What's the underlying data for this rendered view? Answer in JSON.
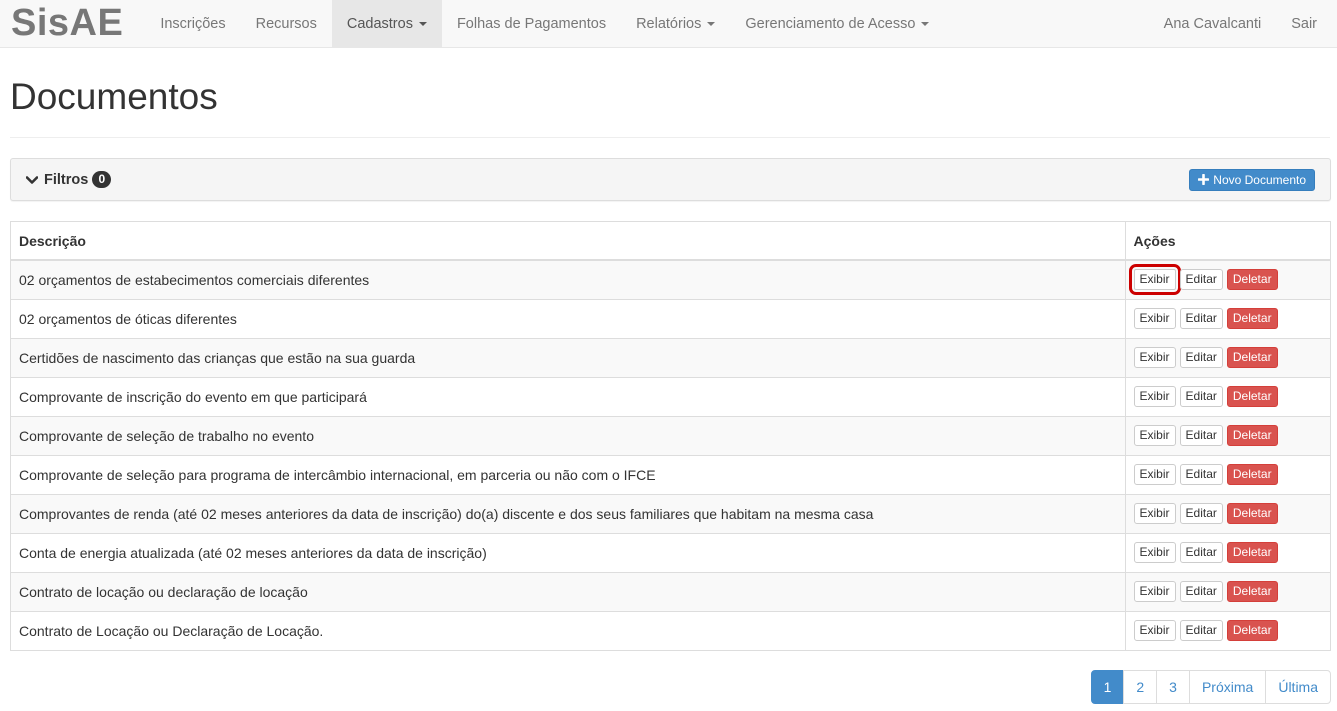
{
  "navbar": {
    "brand": "SisAE",
    "items": [
      {
        "label": "Inscrições",
        "active": false,
        "dropdown": false
      },
      {
        "label": "Recursos",
        "active": false,
        "dropdown": false
      },
      {
        "label": "Cadastros",
        "active": true,
        "dropdown": true
      },
      {
        "label": "Folhas de Pagamentos",
        "active": false,
        "dropdown": false
      },
      {
        "label": "Relatórios",
        "active": false,
        "dropdown": true
      },
      {
        "label": "Gerenciamento de Acesso",
        "active": false,
        "dropdown": true
      }
    ],
    "user": "Ana Cavalcanti",
    "logout": "Sair"
  },
  "page": {
    "title": "Documentos"
  },
  "filters": {
    "label": "Filtros",
    "count": "0",
    "new_button": "Novo Documento"
  },
  "table": {
    "headers": {
      "description": "Descrição",
      "actions": "Ações"
    },
    "action_labels": {
      "view": "Exibir",
      "edit": "Editar",
      "delete": "Deletar"
    },
    "rows": [
      "02 orçamentos de estabecimentos comerciais diferentes",
      "02 orçamentos de óticas diferentes",
      "Certidões de nascimento das crianças que estão na sua guarda",
      "Comprovante de inscrição do evento em que participará",
      "Comprovante de seleção de trabalho no evento",
      "Comprovante de seleção para programa de intercâmbio internacional, em parceria ou não com o IFCE",
      "Comprovantes de renda (até 02 meses anteriores da data de inscrição) do(a) discente e dos seus familiares que habitam na mesma casa",
      "Conta de energia atualizada (até 02 meses anteriores da data de inscrição)",
      "Contrato de locação ou declaração de locação",
      "Contrato de Locação ou Declaração de Locação."
    ]
  },
  "pagination": {
    "pages": [
      "1",
      "2",
      "3"
    ],
    "current": "1",
    "next": "Próxima",
    "last": "Última"
  },
  "colors": {
    "primary": "#428bca",
    "danger": "#d9534f",
    "highlight": "#cc0000"
  }
}
